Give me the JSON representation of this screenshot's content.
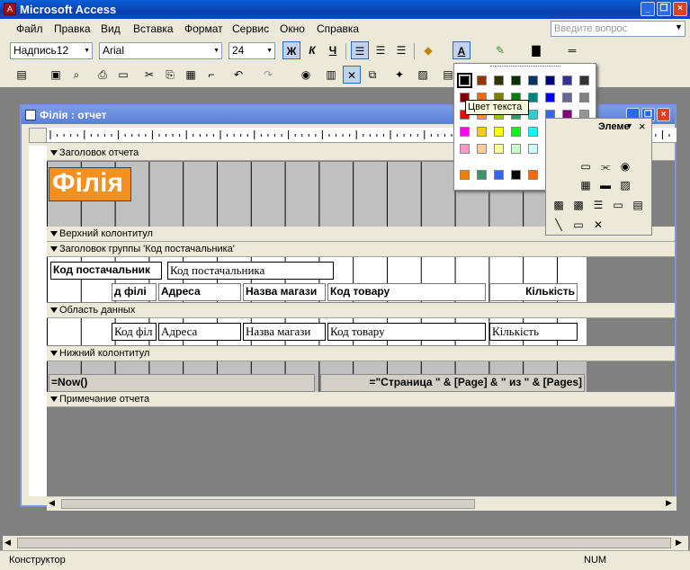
{
  "app": {
    "title": "Microsoft Access",
    "icon": "access-icon",
    "min_icon": "minimize-icon",
    "restore_icon": "restore-icon",
    "close_icon": "close-icon"
  },
  "menu": [
    "Файл",
    "Правка",
    "Вид",
    "Вставка",
    "Формат",
    "Сервис",
    "Окно",
    "Справка"
  ],
  "ask": {
    "placeholder": "Введите вопрос"
  },
  "format_toolbar": {
    "object": "Надпись12",
    "font": "Arial",
    "size": "24",
    "bold": "Ж",
    "italic": "К",
    "underline": "Ч"
  },
  "report": {
    "title": "Філія : отчет",
    "icon": "report-icon"
  },
  "sections": {
    "report_header": "Заголовок отчета",
    "page_header": "Верхний колонтитул",
    "group_header": "Заголовок группы 'Код постачальника'",
    "detail": "Область данных",
    "page_footer": "Нижний колонтитул",
    "report_footer": "Примечание отчета"
  },
  "controls": {
    "report_title": "Філія",
    "group_label": "Код постачальник",
    "group_field": "Код постачальника",
    "head_branch": "д філі",
    "head_address": "Адреса",
    "head_store": "Назва магази",
    "head_product": "Код товару",
    "head_qty": "Кількість",
    "det_branch": "Код філ",
    "det_address": "Адреса",
    "det_store": "Назва магази",
    "det_product": "Код товару",
    "det_qty": "Кількість",
    "footer_now": "=Now()",
    "footer_page": "=\"Страница \" & [Page] & \" из \" & [Pages]"
  },
  "palette": {
    "tooltip": "Цвет текста",
    "rows": [
      [
        "#000000",
        "#993300",
        "#333300",
        "#003300",
        "#003366",
        "#000080",
        "#333399",
        "#333333"
      ],
      [
        "#800000",
        "#ff6600",
        "#808000",
        "#008000",
        "#008080",
        "#0000ff",
        "#666699",
        "#808080"
      ],
      [
        "#ff0000",
        "#ff9900",
        "#99cc00",
        "#339966",
        "#33cccc",
        "#3366ff",
        "#800080",
        "#969696"
      ],
      [
        "#ff00ff",
        "#ffcc00",
        "#ffff00",
        "#00ff00",
        "#00ffff",
        "#00ccff",
        "#993366",
        "#c0c0c0"
      ],
      [
        "#ff99cc",
        "#ffcc99",
        "#ffff99",
        "#ccffcc",
        "#ccffff",
        "#99ccff",
        "#cc99ff",
        "#ffffff"
      ]
    ],
    "custom": [
      "#f08000",
      "#339966",
      "#3366ff",
      "#000000",
      "#ff6600",
      "#ccffff"
    ]
  },
  "toolbox": {
    "title": "Элеме"
  },
  "status": {
    "mode": "Конструктор",
    "num": "NUM"
  }
}
